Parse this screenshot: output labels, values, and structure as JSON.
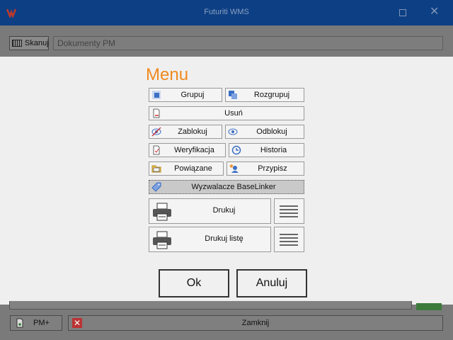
{
  "window": {
    "title": "Futuriti WMS"
  },
  "toolbar": {
    "scan_label": "Skanuj",
    "document_placeholder": "Dokumenty PM"
  },
  "menu": {
    "title": "Menu",
    "group": "Grupuj",
    "ungroup": "Rozgrupuj",
    "delete": "Usuń",
    "lock": "Zablokuj",
    "unlock": "Odblokuj",
    "verify": "Weryfikacja",
    "history": "Historia",
    "related": "Powiązane",
    "assign": "Przypisz",
    "baselinker": "Wyzwalacze BaseLinker",
    "print": "Drukuj",
    "print_list": "Drukuj listę"
  },
  "dialog": {
    "ok": "Ok",
    "cancel": "Anuluj"
  },
  "footer": {
    "pm_plus": "PM+",
    "close": "Zamknij"
  },
  "colors": {
    "titlebar": "#0d3f84",
    "menu_title": "#f08a1e"
  }
}
